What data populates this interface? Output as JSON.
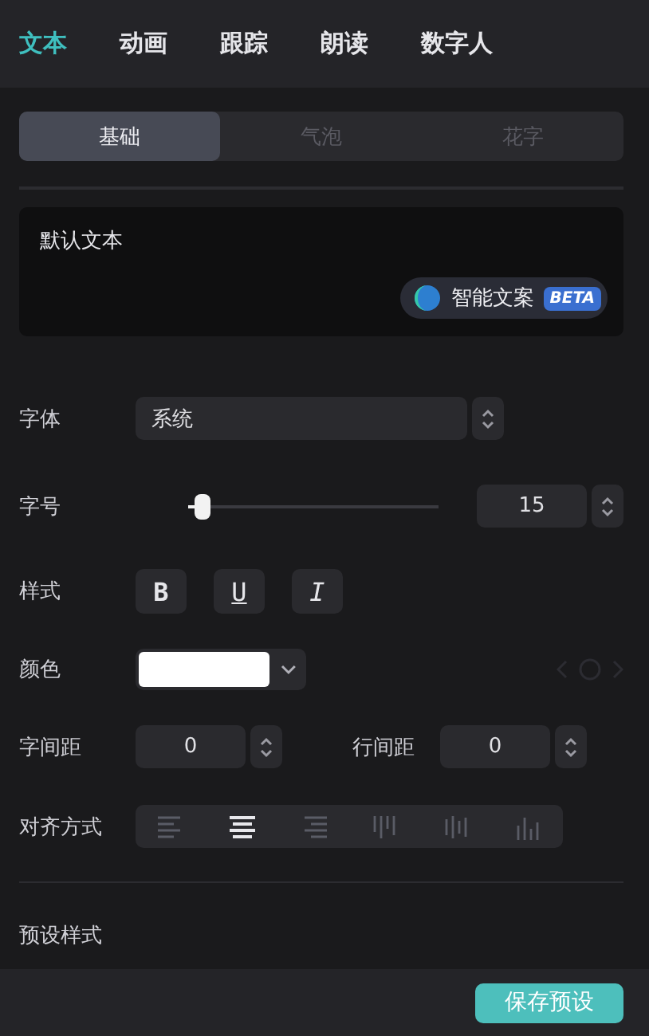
{
  "tabs": [
    {
      "label": "文本",
      "selected": true
    },
    {
      "label": "动画",
      "selected": false
    },
    {
      "label": "跟踪",
      "selected": false
    },
    {
      "label": "朗读",
      "selected": false
    },
    {
      "label": "数字人",
      "selected": false
    }
  ],
  "subtabs": [
    {
      "label": "基础",
      "selected": true
    },
    {
      "label": "气泡",
      "selected": false
    },
    {
      "label": "花字",
      "selected": false
    }
  ],
  "text_box": {
    "value": "默认文本",
    "ai_button": {
      "label": "智能文案",
      "badge": "BETA"
    }
  },
  "font": {
    "label": "字体",
    "value": "系统"
  },
  "size": {
    "label": "字号",
    "level": 0.03,
    "value": "15"
  },
  "style": {
    "label": "样式",
    "buttons": [
      {
        "kind": "bold",
        "text": "B"
      },
      {
        "kind": "underline",
        "text": "U"
      },
      {
        "kind": "italic",
        "text": "I"
      }
    ]
  },
  "color": {
    "label": "颜色",
    "color": "#ffffff"
  },
  "letter_spacing": {
    "label": "字间距",
    "value": "0"
  },
  "line_spacing": {
    "label": "行间距",
    "value": "0"
  },
  "alignment": {
    "label": "对齐方式",
    "options": [
      {
        "kind": "left",
        "selected": false
      },
      {
        "kind": "center",
        "selected": true
      },
      {
        "kind": "right",
        "selected": false
      },
      {
        "kind": "top",
        "selected": false
      },
      {
        "kind": "middle",
        "selected": false
      },
      {
        "kind": "bottom",
        "selected": false
      }
    ]
  },
  "presets": {
    "label": "预设样式"
  },
  "save_button": "保存预设"
}
